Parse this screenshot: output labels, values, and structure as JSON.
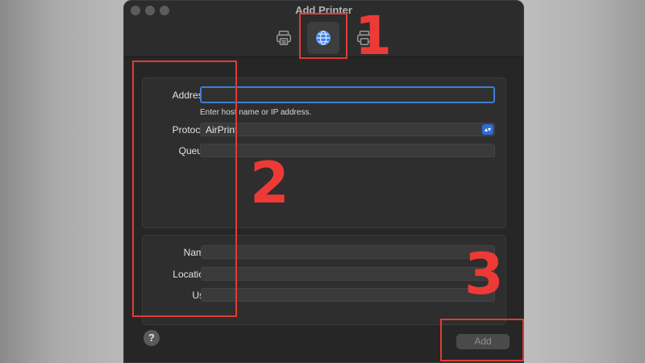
{
  "window": {
    "title": "Add Printer"
  },
  "toolbar": {
    "tabs": [
      {
        "icon": "printer-icon",
        "selected": false
      },
      {
        "icon": "globe-icon",
        "selected": true
      },
      {
        "icon": "windows-printer-icon",
        "selected": false
      }
    ]
  },
  "form": {
    "address_label": "Address:",
    "address_value": "",
    "address_hint": "Enter host name or IP address.",
    "protocol_label": "Protocol:",
    "protocol_value": "AirPrint",
    "queue_label": "Queue:",
    "queue_value": "",
    "name_label": "Name:",
    "name_value": "",
    "location_label": "Location:",
    "location_value": "",
    "use_label": "Use:",
    "use_value": ""
  },
  "footer": {
    "help_label": "?",
    "add_label": "Add"
  },
  "annotations": {
    "step1": "1",
    "step2": "2",
    "step3": "3",
    "color": "#e23a35"
  },
  "colors": {
    "focus_ring": "#3c7fd5",
    "select_accent": "#2f6bd8"
  }
}
